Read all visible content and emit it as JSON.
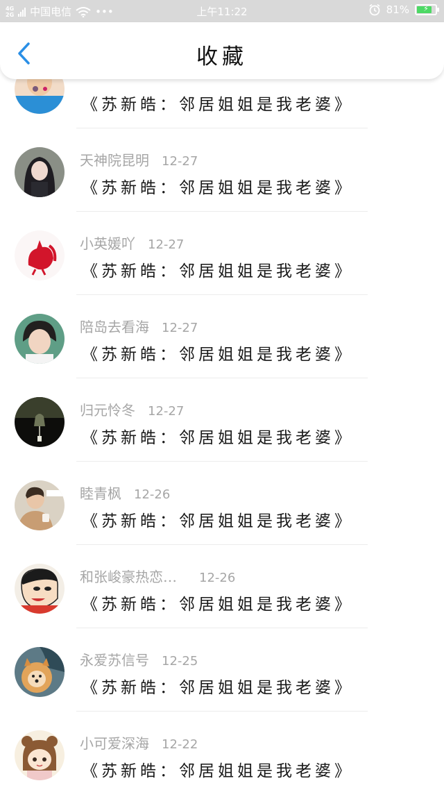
{
  "status_bar": {
    "network": "4G²|2G",
    "carrier": "中国电信",
    "dots": "•••",
    "time": "上午11:22",
    "battery_percent": "81%",
    "battery_level": 0.81,
    "wifi_icon": "wifi-icon",
    "alarm_icon": "alarm-icon"
  },
  "header": {
    "title": "收藏",
    "back_icon": "chevron-left-icon"
  },
  "colors": {
    "accent": "#2a8fe6",
    "meta_text": "#a6a6a6",
    "title_text": "#1a1a1a",
    "status_bar_bg": "#d9d9d9",
    "battery": "#4cd964"
  },
  "items": [
    {
      "user": "",
      "date": "",
      "title": "《苏新皓：邻居姐姐是我老婆》",
      "avatar": "child-blue-shirt"
    },
    {
      "user": "天神院昆明",
      "date": "12-27",
      "title": "《苏新皓：邻居姐姐是我老婆》",
      "avatar": "anime-girl-dark-hair"
    },
    {
      "user": "小英媛吖",
      "date": "12-27",
      "title": "《苏新皓：邻居姐姐是我老婆》",
      "avatar": "red-paper-cut-rooster"
    },
    {
      "user": "陪岛去看海",
      "date": "12-27",
      "title": "《苏新皓：邻居姐姐是我老婆》",
      "avatar": "boy-portrait"
    },
    {
      "user": "归元怜冬",
      "date": "12-27",
      "title": "《苏新皓：邻居姐姐是我老婆》",
      "avatar": "wind-chime-dark"
    },
    {
      "user": "睦青枫",
      "date": "12-26",
      "title": "《苏新皓：邻居姐姐是我老婆》",
      "avatar": "man-holding-cup"
    },
    {
      "user": "和张峻豪热恋…",
      "date": "12-26",
      "title": "《苏新皓：邻居姐姐是我老婆》",
      "avatar": "crayon-shinchan"
    },
    {
      "user": "永爱苏信号",
      "date": "12-25",
      "title": "《苏新皓：邻居姐姐是我老婆》",
      "avatar": "pomeranian-dog"
    },
    {
      "user": "小可爱深海",
      "date": "12-22",
      "title": "《苏新皓：邻居姐姐是我老婆》",
      "avatar": "cartoon-girl-bear-ears"
    }
  ]
}
